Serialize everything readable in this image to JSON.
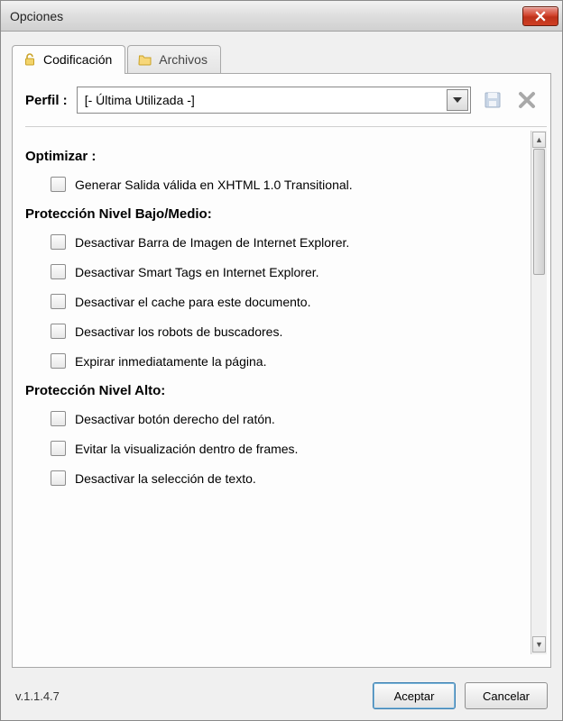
{
  "window": {
    "title": "Opciones"
  },
  "tabs": {
    "codificacion": "Codificación",
    "archivos": "Archivos"
  },
  "profile": {
    "label": "Perfil :",
    "selected": "[- Última Utilizada -]"
  },
  "sections": {
    "optimizar": {
      "title": "Optimizar :"
    },
    "bajo_medio": {
      "title": "Protección Nivel Bajo/Medio:"
    },
    "alto": {
      "title": "Protección Nivel Alto:"
    }
  },
  "opts": {
    "xhtml": "Generar Salida válida en XHTML 1.0 Transitional.",
    "barra_ie": "Desactivar Barra de Imagen de Internet Explorer.",
    "smart_tags": "Desactivar Smart Tags en Internet Explorer.",
    "cache": "Desactivar el cache para este documento.",
    "robots": "Desactivar los robots de buscadores.",
    "expirar": "Expirar inmediatamente la página.",
    "boton_derecho": "Desactivar botón derecho del ratón.",
    "frames": "Evitar la visualización dentro de frames.",
    "seleccion": "Desactivar la selección de texto."
  },
  "footer": {
    "version": "v.1.1.4.7",
    "aceptar": "Aceptar",
    "cancelar": "Cancelar"
  }
}
